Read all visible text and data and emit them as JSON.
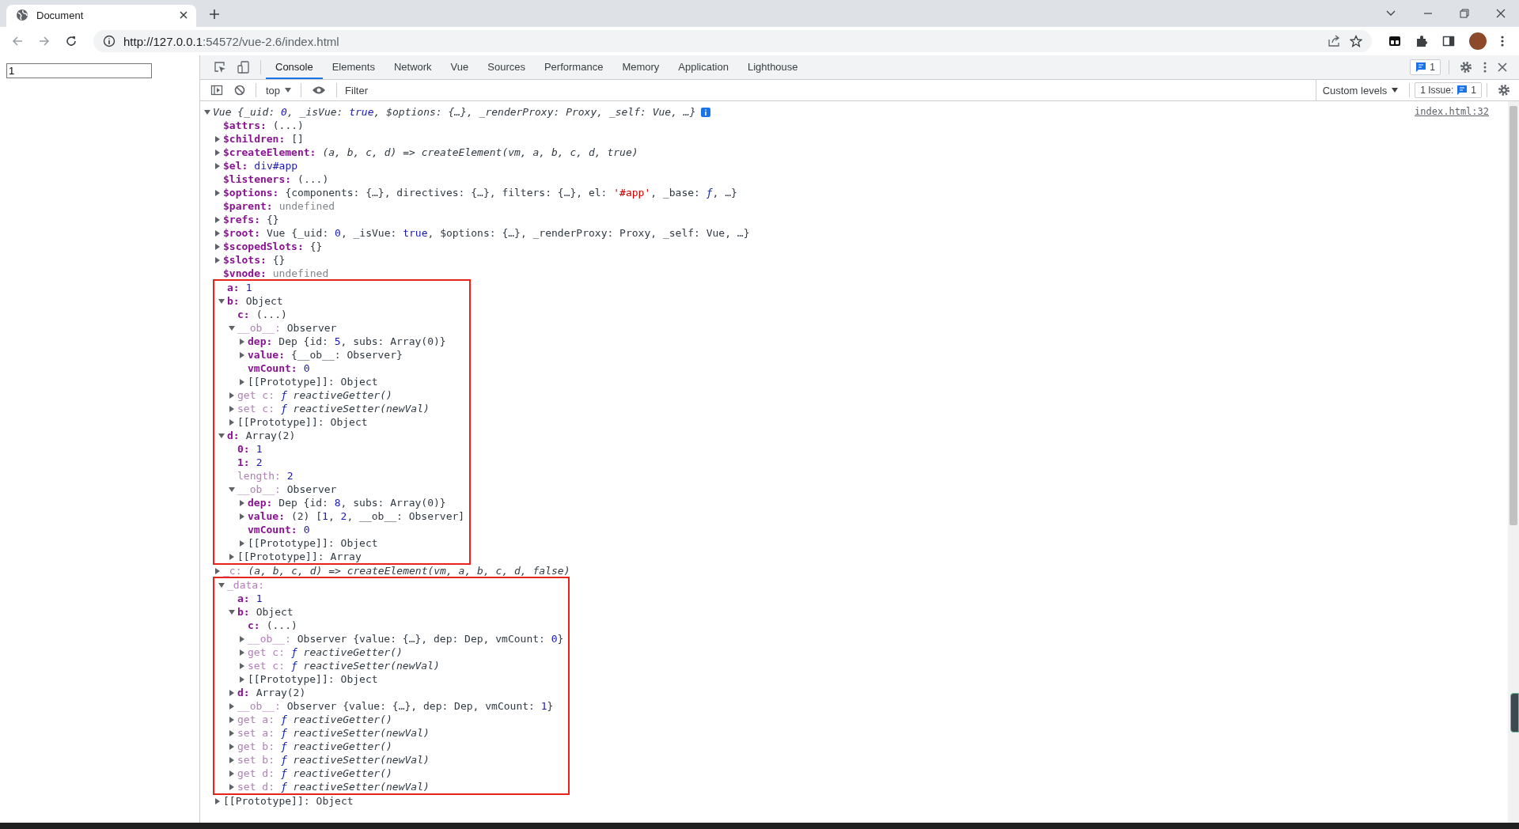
{
  "browser": {
    "tabs": [
      {
        "title": "Document",
        "selected": true
      }
    ],
    "address_host": "http://127.0.0.1",
    "address_rest": ":54572/vue-2.6/index.html"
  },
  "page": {
    "input_value": "1"
  },
  "devtools": {
    "tabs": [
      {
        "label": "Console",
        "selected": true
      },
      {
        "label": "Elements",
        "selected": false
      },
      {
        "label": "Network",
        "selected": false
      },
      {
        "label": "Vue",
        "selected": false
      },
      {
        "label": "Sources",
        "selected": false
      },
      {
        "label": "Performance",
        "selected": false
      },
      {
        "label": "Memory",
        "selected": false
      },
      {
        "label": "Application",
        "selected": false
      },
      {
        "label": "Lighthouse",
        "selected": false
      }
    ],
    "messages_badge": "1",
    "console_toolbar": {
      "context": "top",
      "filter_placeholder": "Filter",
      "levels": "Custom levels",
      "issues_label": "1 Issue:",
      "issues_count": "1"
    },
    "source_link": "index.html:32",
    "tree": {
      "kind": "toggle",
      "expanded": true,
      "value": [
        {
          "kind": "ital",
          "text": "Vue {_uid: "
        },
        {
          "kind": "ital-num",
          "text": "0"
        },
        {
          "kind": "ital",
          "text": ", _isVue: "
        },
        {
          "kind": "ital-num",
          "text": "true"
        },
        {
          "kind": "ital",
          "text": ", $options: {…}, _renderProxy: Proxy, _self: Vue, …}"
        }
      ],
      "children": [
        {
          "kind": "leaf",
          "key": {
            "kind": "own",
            "text": "$attrs:"
          },
          "value": [
            {
              "kind": "plain",
              "text": "(...)"
            }
          ]
        },
        {
          "kind": "toggle",
          "expanded": false,
          "key": {
            "kind": "own",
            "text": "$children:"
          },
          "value": [
            {
              "kind": "plain",
              "text": "[]"
            }
          ]
        },
        {
          "kind": "toggle",
          "expanded": false,
          "key": {
            "kind": "own",
            "text": "$createElement:"
          },
          "value": [
            {
              "kind": "ital",
              "text": "(a, b, c, d) => createElement(vm, a, b, c, d, true)"
            }
          ]
        },
        {
          "kind": "toggle",
          "expanded": false,
          "key": {
            "kind": "own",
            "text": "$el:"
          },
          "value": [
            {
              "kind": "num",
              "text": "div#app"
            }
          ]
        },
        {
          "kind": "leaf",
          "key": {
            "kind": "own",
            "text": "$listeners:"
          },
          "value": [
            {
              "kind": "plain",
              "text": "(...)"
            }
          ]
        },
        {
          "kind": "toggle",
          "expanded": false,
          "key": {
            "kind": "own",
            "text": "$options:"
          },
          "value": [
            {
              "kind": "plain",
              "text": "{components: {…}, directives: {…}, filters: {…}, el: "
            },
            {
              "kind": "str",
              "text": "'#app'"
            },
            {
              "kind": "plain",
              "text": ", _base: "
            },
            {
              "kind": "fn",
              "text": "ƒ"
            },
            {
              "kind": "plain",
              "text": ", …}"
            }
          ]
        },
        {
          "kind": "leaf",
          "key": {
            "kind": "own",
            "text": "$parent:"
          },
          "value": [
            {
              "kind": "dim",
              "text": "undefined"
            }
          ]
        },
        {
          "kind": "toggle",
          "expanded": false,
          "key": {
            "kind": "own",
            "text": "$refs:"
          },
          "value": [
            {
              "kind": "plain",
              "text": "{}"
            }
          ]
        },
        {
          "kind": "toggle",
          "expanded": false,
          "key": {
            "kind": "own",
            "text": "$root:"
          },
          "value": [
            {
              "kind": "plain",
              "text": "Vue {_uid: "
            },
            {
              "kind": "num",
              "text": "0"
            },
            {
              "kind": "plain",
              "text": ", _isVue: "
            },
            {
              "kind": "num",
              "text": "true"
            },
            {
              "kind": "plain",
              "text": ", $options: {…}, _renderProxy: Proxy, _self: Vue, …}"
            }
          ]
        },
        {
          "kind": "toggle",
          "expanded": false,
          "key": {
            "kind": "own",
            "text": "$scopedSlots:"
          },
          "value": [
            {
              "kind": "plain",
              "text": "{}"
            }
          ]
        },
        {
          "kind": "toggle",
          "expanded": false,
          "key": {
            "kind": "own",
            "text": "$slots:"
          },
          "value": [
            {
              "kind": "plain",
              "text": "{}"
            }
          ]
        },
        {
          "kind": "leaf",
          "key": {
            "kind": "own",
            "text": "$vnode:"
          },
          "value": [
            {
              "kind": "dim",
              "text": "undefined"
            }
          ]
        },
        {
          "kind": "leaf",
          "highlighted": true,
          "key": {
            "kind": "own",
            "text": "a:"
          },
          "value": [
            {
              "kind": "num",
              "text": "1"
            }
          ]
        },
        {
          "kind": "toggle",
          "expanded": true,
          "highlighted": true,
          "key": {
            "kind": "own",
            "text": "b:"
          },
          "value": [
            {
              "kind": "plain",
              "text": "Object"
            }
          ],
          "children": [
            {
              "kind": "leaf",
              "key": {
                "kind": "own",
                "text": "c:"
              },
              "value": [
                {
                  "kind": "plain",
                  "text": "(...)"
                }
              ]
            },
            {
              "kind": "toggle",
              "expanded": true,
              "key": {
                "kind": "dim",
                "text": "__ob__:"
              },
              "value": [
                {
                  "kind": "plain",
                  "text": "Observer"
                }
              ],
              "children": [
                {
                  "kind": "toggle",
                  "expanded": false,
                  "key": {
                    "kind": "own",
                    "text": "dep:"
                  },
                  "value": [
                    {
                      "kind": "plain",
                      "text": "Dep {id: "
                    },
                    {
                      "kind": "num",
                      "text": "5"
                    },
                    {
                      "kind": "plain",
                      "text": ", subs: Array(0)}"
                    }
                  ]
                },
                {
                  "kind": "toggle",
                  "expanded": false,
                  "key": {
                    "kind": "own",
                    "text": "value:"
                  },
                  "value": [
                    {
                      "kind": "plain",
                      "text": "{__ob__: Observer}"
                    }
                  ]
                },
                {
                  "kind": "leaf",
                  "key": {
                    "kind": "own",
                    "text": "vmCount:"
                  },
                  "value": [
                    {
                      "kind": "num",
                      "text": "0"
                    }
                  ]
                },
                {
                  "kind": "toggle",
                  "expanded": false,
                  "key": {
                    "kind": "internal",
                    "text": "[[Prototype]]:"
                  },
                  "value": [
                    {
                      "kind": "plain",
                      "text": "Object"
                    }
                  ]
                }
              ]
            },
            {
              "kind": "toggle",
              "expanded": false,
              "key": {
                "kind": "dim",
                "text": "get c:"
              },
              "value": [
                {
                  "kind": "fn",
                  "text": "ƒ"
                },
                {
                  "kind": "ital",
                  "text": " reactiveGetter()"
                }
              ]
            },
            {
              "kind": "toggle",
              "expanded": false,
              "key": {
                "kind": "dim",
                "text": "set c:"
              },
              "value": [
                {
                  "kind": "fn",
                  "text": "ƒ"
                },
                {
                  "kind": "ital",
                  "text": " reactiveSetter(newVal)"
                }
              ]
            },
            {
              "kind": "toggle",
              "expanded": false,
              "key": {
                "kind": "internal",
                "text": "[[Prototype]]:"
              },
              "value": [
                {
                  "kind": "plain",
                  "text": "Object"
                }
              ]
            }
          ]
        },
        {
          "kind": "toggle",
          "expanded": true,
          "highlighted": true,
          "key": {
            "kind": "own",
            "text": "d:"
          },
          "value": [
            {
              "kind": "plain",
              "text": "Array(2)"
            }
          ],
          "children": [
            {
              "kind": "leaf",
              "key": {
                "kind": "own",
                "text": "0:"
              },
              "value": [
                {
                  "kind": "num",
                  "text": "1"
                }
              ]
            },
            {
              "kind": "leaf",
              "key": {
                "kind": "own",
                "text": "1:"
              },
              "value": [
                {
                  "kind": "num",
                  "text": "2"
                }
              ]
            },
            {
              "kind": "leaf",
              "key": {
                "kind": "dim",
                "text": "length:"
              },
              "value": [
                {
                  "kind": "num",
                  "text": "2"
                }
              ]
            },
            {
              "kind": "toggle",
              "expanded": true,
              "key": {
                "kind": "dim",
                "text": "__ob__:"
              },
              "value": [
                {
                  "kind": "plain",
                  "text": "Observer"
                }
              ],
              "children": [
                {
                  "kind": "toggle",
                  "expanded": false,
                  "key": {
                    "kind": "own",
                    "text": "dep:"
                  },
                  "value": [
                    {
                      "kind": "plain",
                      "text": "Dep {id: "
                    },
                    {
                      "kind": "num",
                      "text": "8"
                    },
                    {
                      "kind": "plain",
                      "text": ", subs: Array(0)}"
                    }
                  ]
                },
                {
                  "kind": "toggle",
                  "expanded": false,
                  "key": {
                    "kind": "own",
                    "text": "value:"
                  },
                  "value": [
                    {
                      "kind": "plain",
                      "text": "(2) ["
                    },
                    {
                      "kind": "num",
                      "text": "1"
                    },
                    {
                      "kind": "plain",
                      "text": ", "
                    },
                    {
                      "kind": "num",
                      "text": "2"
                    },
                    {
                      "kind": "plain",
                      "text": ", __ob__: Observer]"
                    }
                  ]
                },
                {
                  "kind": "leaf",
                  "key": {
                    "kind": "own",
                    "text": "vmCount:"
                  },
                  "value": [
                    {
                      "kind": "num",
                      "text": "0"
                    }
                  ]
                },
                {
                  "kind": "toggle",
                  "expanded": false,
                  "key": {
                    "kind": "internal",
                    "text": "[[Prototype]]:"
                  },
                  "value": [
                    {
                      "kind": "plain",
                      "text": "Object"
                    }
                  ]
                }
              ]
            },
            {
              "kind": "toggle",
              "expanded": false,
              "key": {
                "kind": "internal",
                "text": "[[Prototype]]:"
              },
              "value": [
                {
                  "kind": "plain",
                  "text": "Array"
                }
              ]
            }
          ]
        },
        {
          "kind": "toggle",
          "expanded": false,
          "key": {
            "kind": "dim",
            "text": "_c:"
          },
          "value": [
            {
              "kind": "ital",
              "text": "(a, b, c, d) => createElement(vm, a, b, c, d, false)"
            }
          ]
        },
        {
          "kind": "toggle",
          "expanded": true,
          "highlighted": true,
          "key": {
            "kind": "dim",
            "text": "_data:"
          },
          "children": [
            {
              "kind": "leaf",
              "key": {
                "kind": "own",
                "text": "a:"
              },
              "value": [
                {
                  "kind": "num",
                  "text": "1"
                }
              ]
            },
            {
              "kind": "toggle",
              "expanded": true,
              "key": {
                "kind": "own",
                "text": "b:"
              },
              "value": [
                {
                  "kind": "plain",
                  "text": "Object"
                }
              ],
              "children": [
                {
                  "kind": "leaf",
                  "key": {
                    "kind": "own",
                    "text": "c:"
                  },
                  "value": [
                    {
                      "kind": "plain",
                      "text": "(...)"
                    }
                  ]
                },
                {
                  "kind": "toggle",
                  "expanded": false,
                  "key": {
                    "kind": "dim",
                    "text": "__ob__:"
                  },
                  "value": [
                    {
                      "kind": "plain",
                      "text": "Observer {value: {…}, dep: Dep, vmCount: "
                    },
                    {
                      "kind": "num",
                      "text": "0"
                    },
                    {
                      "kind": "plain",
                      "text": "}"
                    }
                  ]
                },
                {
                  "kind": "toggle",
                  "expanded": false,
                  "key": {
                    "kind": "dim",
                    "text": "get c:"
                  },
                  "value": [
                    {
                      "kind": "fn",
                      "text": "ƒ"
                    },
                    {
                      "kind": "ital",
                      "text": " reactiveGetter()"
                    }
                  ]
                },
                {
                  "kind": "toggle",
                  "expanded": false,
                  "key": {
                    "kind": "dim",
                    "text": "set c:"
                  },
                  "value": [
                    {
                      "kind": "fn",
                      "text": "ƒ"
                    },
                    {
                      "kind": "ital",
                      "text": " reactiveSetter(newVal)"
                    }
                  ]
                },
                {
                  "kind": "toggle",
                  "expanded": false,
                  "key": {
                    "kind": "internal",
                    "text": "[[Prototype]]:"
                  },
                  "value": [
                    {
                      "kind": "plain",
                      "text": "Object"
                    }
                  ]
                }
              ]
            },
            {
              "kind": "toggle",
              "expanded": false,
              "key": {
                "kind": "own",
                "text": "d:"
              },
              "value": [
                {
                  "kind": "plain",
                  "text": "Array(2)"
                }
              ]
            },
            {
              "kind": "toggle",
              "expanded": false,
              "key": {
                "kind": "dim",
                "text": "__ob__:"
              },
              "value": [
                {
                  "kind": "plain",
                  "text": "Observer {value: {…}, dep: Dep, vmCount: "
                },
                {
                  "kind": "num",
                  "text": "1"
                },
                {
                  "kind": "plain",
                  "text": "}"
                }
              ]
            },
            {
              "kind": "toggle",
              "expanded": false,
              "key": {
                "kind": "dim",
                "text": "get a:"
              },
              "value": [
                {
                  "kind": "fn",
                  "text": "ƒ"
                },
                {
                  "kind": "ital",
                  "text": " reactiveGetter()"
                }
              ]
            },
            {
              "kind": "toggle",
              "expanded": false,
              "key": {
                "kind": "dim",
                "text": "set a:"
              },
              "value": [
                {
                  "kind": "fn",
                  "text": "ƒ"
                },
                {
                  "kind": "ital",
                  "text": " reactiveSetter(newVal)"
                }
              ]
            },
            {
              "kind": "toggle",
              "expanded": false,
              "key": {
                "kind": "dim",
                "text": "get b:"
              },
              "value": [
                {
                  "kind": "fn",
                  "text": "ƒ"
                },
                {
                  "kind": "ital",
                  "text": " reactiveGetter()"
                }
              ]
            },
            {
              "kind": "toggle",
              "expanded": false,
              "key": {
                "kind": "dim",
                "text": "set b:"
              },
              "value": [
                {
                  "kind": "fn",
                  "text": "ƒ"
                },
                {
                  "kind": "ital",
                  "text": " reactiveSetter(newVal)"
                }
              ]
            },
            {
              "kind": "toggle",
              "expanded": false,
              "key": {
                "kind": "dim",
                "text": "get d:"
              },
              "value": [
                {
                  "kind": "fn",
                  "text": "ƒ"
                },
                {
                  "kind": "ital",
                  "text": " reactiveGetter()"
                }
              ]
            },
            {
              "kind": "toggle",
              "expanded": false,
              "key": {
                "kind": "dim",
                "text": "set d:"
              },
              "value": [
                {
                  "kind": "fn",
                  "text": "ƒ"
                },
                {
                  "kind": "ital",
                  "text": " reactiveSetter(newVal)"
                }
              ]
            }
          ]
        },
        {
          "kind": "toggle",
          "expanded": false,
          "key": {
            "kind": "internal",
            "text": "[[Prototype]]:"
          },
          "value": [
            {
              "kind": "plain",
              "text": "Object"
            }
          ]
        }
      ]
    }
  }
}
